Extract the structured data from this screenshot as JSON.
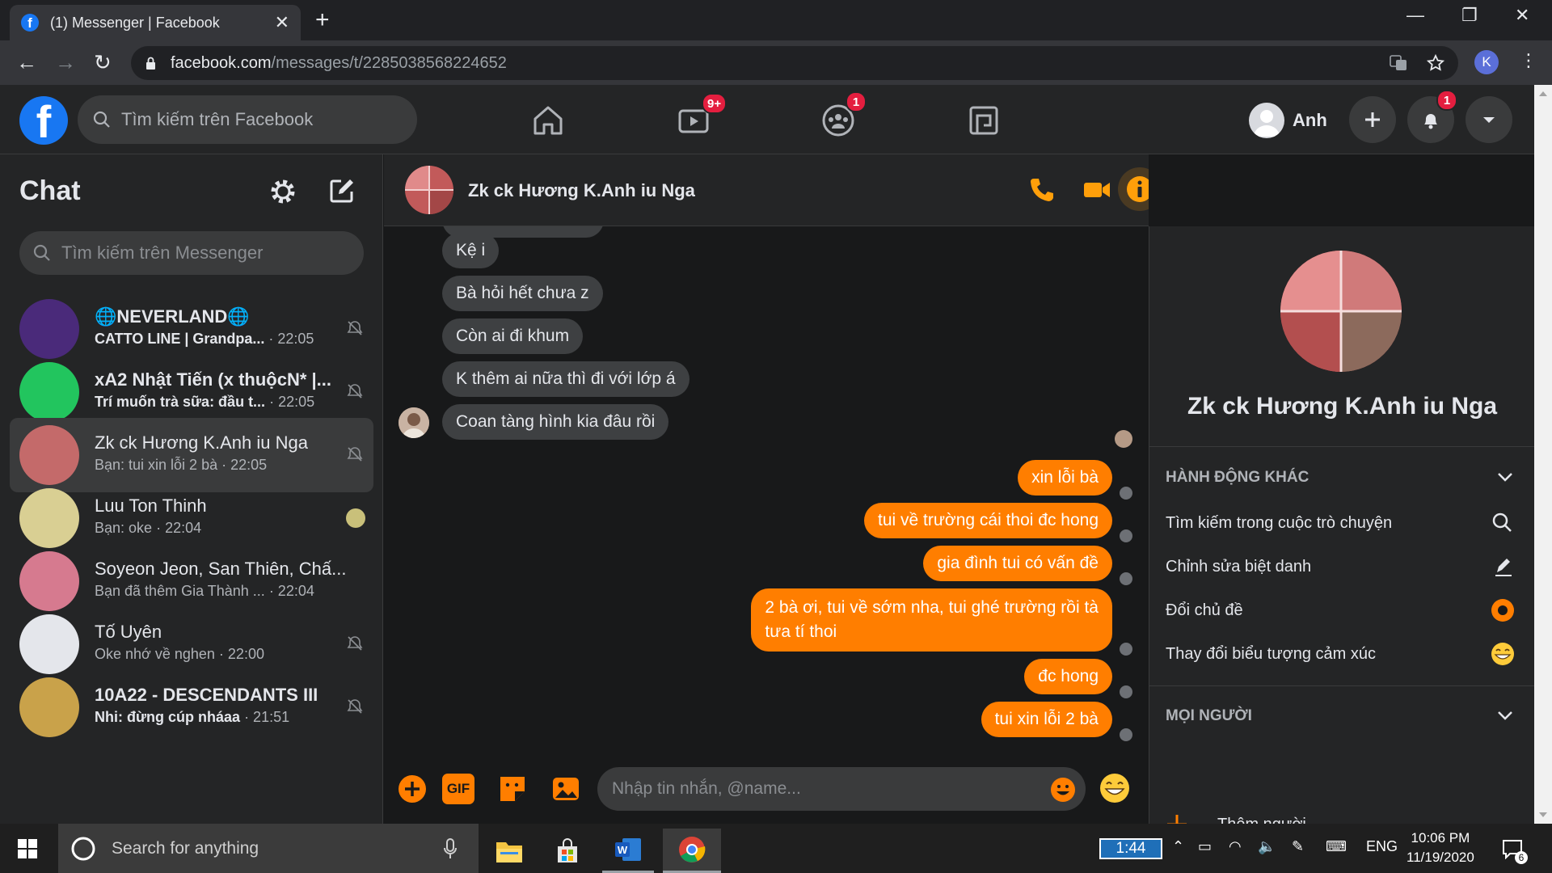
{
  "browser": {
    "tab_title": "(1) Messenger | Facebook",
    "new_tab": "+",
    "close_tab": "✕",
    "url_host": "facebook.com",
    "url_path": "/messages/t/2285038568224652",
    "profile_initial": "K"
  },
  "fb": {
    "logo": "f",
    "search_placeholder": "Tìm kiếm trên Facebook",
    "watch_badge": "9+",
    "groups_badge": "1",
    "notif_badge": "1",
    "user_name": "Anh"
  },
  "sidebar": {
    "title": "Chat",
    "search_placeholder": "Tìm kiếm trên Messenger",
    "conversations": [
      {
        "name": "🌐NEVERLAND🌐",
        "preview": "CATTO LINE | Grandpa...",
        "time": "· 22:05",
        "unread": true,
        "color": "#4a2a7a"
      },
      {
        "name": "xA2 Nhật Tiến (x thuộcN* |...",
        "preview": "Trí muốn trà sữa: đầu t...",
        "time": "· 22:05",
        "unread": true,
        "color": "#22c55e"
      },
      {
        "name": "Zk ck Hương K.Anh iu Nga",
        "preview": "Bạn: tui xin lỗi 2 bà",
        "time": "· 22:05",
        "unread": false,
        "color": "#c46a6a"
      },
      {
        "name": "Luu Ton Thinh",
        "preview": "Bạn: oke",
        "time": "· 22:04",
        "unread": false,
        "color": "#d9cf93"
      },
      {
        "name": "Soyeon Jeon, San Thiên, Chấ...",
        "preview": "Bạn đã thêm Gia Thành ...",
        "time": "· 22:04",
        "unread": false,
        "color": "#d67a8f"
      },
      {
        "name": "Tố Uyên",
        "preview": "Oke nhớ về nghen",
        "time": "· 22:00",
        "unread": false,
        "color": "#e4e6eb"
      },
      {
        "name": "10A22 - DESCENDANTS III",
        "preview": "Nhi: đừng cúp nháaa",
        "time": "· 21:51",
        "unread": true,
        "color": "#c9a24a"
      }
    ]
  },
  "conversation": {
    "title": "Zk ck Hương K.Anh iu Nga",
    "incoming": [
      "Kệ i",
      "Bà hỏi hết chưa z",
      "Còn ai đi khum",
      "K thêm ai nữa thì đi với lớp á",
      "Coan tàng hình kia đâu rồi"
    ],
    "outgoing": [
      "xin lỗi bà",
      "tui về trường cái thoi đc hong",
      "gia đình tui có vấn đề",
      "2 bà ơi, tui về sớm nha, tui ghé trường rồi tà",
      "tưa tí thoi",
      "đc hong",
      "tui xin lỗi 2 bà"
    ],
    "input_placeholder": "Nhập tin nhắn, @name...",
    "gif_label": "GIF",
    "accent": "#ff7e00"
  },
  "info": {
    "name": "Zk ck Hương K.Anh iu Nga",
    "section_more": "HÀNH ĐỘNG KHÁC",
    "actions": [
      "Tìm kiếm trong cuộc trò chuyện",
      "Chỉnh sửa biệt danh",
      "Đổi chủ đề",
      "Thay đổi biểu tượng cảm xúc"
    ],
    "section_people": "MỌI NGƯỜI",
    "add_people": "Thêm người"
  },
  "taskbar": {
    "search_placeholder": "Search for anything",
    "battery_time": "1:44",
    "language": "ENG",
    "time": "10:06 PM",
    "date": "11/19/2020",
    "notifications": "6"
  }
}
